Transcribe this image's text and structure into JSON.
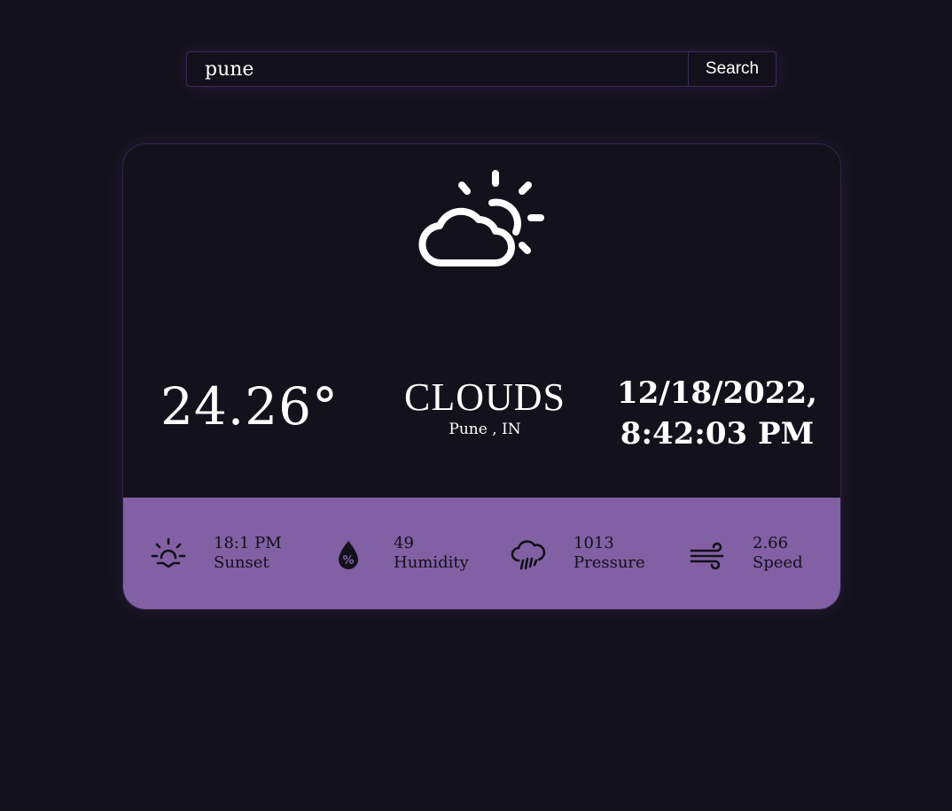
{
  "search": {
    "value": "pune",
    "button_label": "Search"
  },
  "weather": {
    "icon": "sun-behind-cloud-icon",
    "temperature": "24.26°",
    "condition": "CLOUDS",
    "location": "Pune , IN",
    "date": "12/18/2022,",
    "time": "8:42:03 PM"
  },
  "details": [
    {
      "icon": "sunset-icon",
      "value": "18:1 PM",
      "label": "Sunset"
    },
    {
      "icon": "humidity-icon",
      "value": "49",
      "label": "Humidity"
    },
    {
      "icon": "rain-cloud-icon",
      "value": "1013",
      "label": "Pressure"
    },
    {
      "icon": "wind-icon",
      "value": "2.66",
      "label": "Speed"
    }
  ],
  "colors": {
    "background": "#13111b",
    "accent": "#8160a3",
    "text": "#ffffff",
    "strip_text": "#12101a"
  }
}
